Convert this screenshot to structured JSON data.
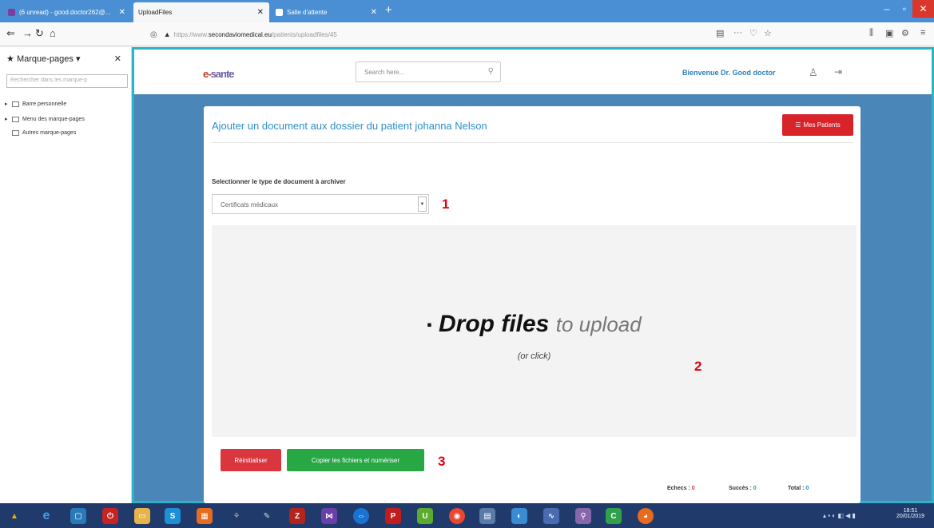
{
  "browser": {
    "tabs": [
      {
        "label": "(6 unread) - good.doctor262@... ",
        "active": false
      },
      {
        "label": "UploadFiles",
        "active": true
      },
      {
        "label": "Salle d'attente",
        "active": false
      }
    ],
    "url_prefix": "https://www.",
    "url_host": "secondaviomedical.eu",
    "url_path": "/patients/uploadfiles/45"
  },
  "sidebar": {
    "title": "Marque-pages",
    "search_placeholder": "Rechercher dans les marque-p",
    "items": [
      {
        "label": "Barre personnelle"
      },
      {
        "label": "Menu des marque-pages"
      },
      {
        "label": "Autres marque-pages"
      }
    ]
  },
  "header": {
    "logo_a": "e-",
    "logo_b": "sante",
    "search_placeholder": "Search here...",
    "welcome": "Bienvenue Dr. Good doctor"
  },
  "card": {
    "title": "Ajouter un document aux dossier du patient johanna Nelson",
    "patients_button": "Mes Patients",
    "select_label": "Selectionner le type de document à archiver",
    "select_value": "Certificats médicaux",
    "drop_bold": "Drop files",
    "drop_light": "to upload",
    "drop_sub": "(or click)",
    "reset_button": "Réinitialiser",
    "copy_button": "Copier les fichiers et numériser",
    "stats": {
      "echecs_label": "Echecs :",
      "echecs": "0",
      "succes_label": "Succès :",
      "succes": "0",
      "total_label": "Total :",
      "total": "0"
    }
  },
  "annotations": [
    "1",
    "2",
    "3"
  ],
  "taskbar": {
    "clock_time": "18:51",
    "clock_date": "20/01/2019"
  },
  "colors": {
    "accent": "#2c8fc9",
    "danger": "#d8232a",
    "success": "#28a745",
    "page_bg": "#4b86b8"
  }
}
